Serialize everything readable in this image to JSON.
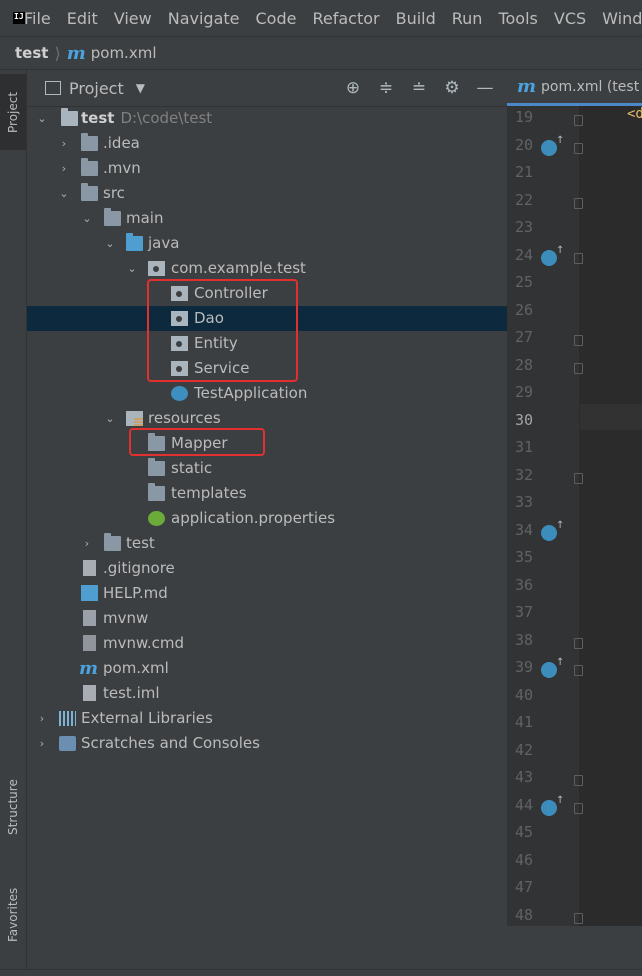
{
  "menu": [
    "File",
    "Edit",
    "View",
    "Navigate",
    "Code",
    "Refactor",
    "Build",
    "Run",
    "Tools",
    "VCS",
    "Window"
  ],
  "breadcrumb": {
    "project": "test",
    "file": "pom.xml"
  },
  "left_strip": {
    "project": "Project",
    "structure": "Structure",
    "favorites": "Favorites"
  },
  "panel": {
    "title": "Project"
  },
  "tree": {
    "root": {
      "name": "test",
      "path": "D:\\code\\test"
    },
    "idea": ".idea",
    "mvn": ".mvn",
    "src": "src",
    "main": "main",
    "java": "java",
    "package": "com.example.test",
    "controller": "Controller",
    "dao": "Dao",
    "entity": "Entity",
    "service": "Service",
    "test_application": "TestApplication",
    "resources": "resources",
    "mapper": "Mapper",
    "static": "static",
    "templates": "templates",
    "app_properties": "application.properties",
    "test": "test",
    "gitignore": ".gitignore",
    "help": "HELP.md",
    "mvnw": "mvnw",
    "mvnw_cmd": "mvnw.cmd",
    "pom": "pom.xml",
    "test_iml": "test.iml",
    "external_libraries": "External Libraries",
    "scratches": "Scratches and Consoles"
  },
  "editor": {
    "tab_label": "pom.xml (test",
    "code_snippet": "<d",
    "line_numbers": [
      "19",
      "20",
      "21",
      "22",
      "23",
      "24",
      "25",
      "26",
      "27",
      "28",
      "29",
      "30",
      "31",
      "32",
      "33",
      "34",
      "35",
      "36",
      "37",
      "38",
      "39",
      "40",
      "41",
      "42",
      "43",
      "44",
      "45",
      "46",
      "47",
      "48"
    ],
    "current_line": "30"
  },
  "colors": {
    "selection": "#0d293e",
    "highlight_box": "#e03030",
    "accent": "#4a88c7"
  }
}
